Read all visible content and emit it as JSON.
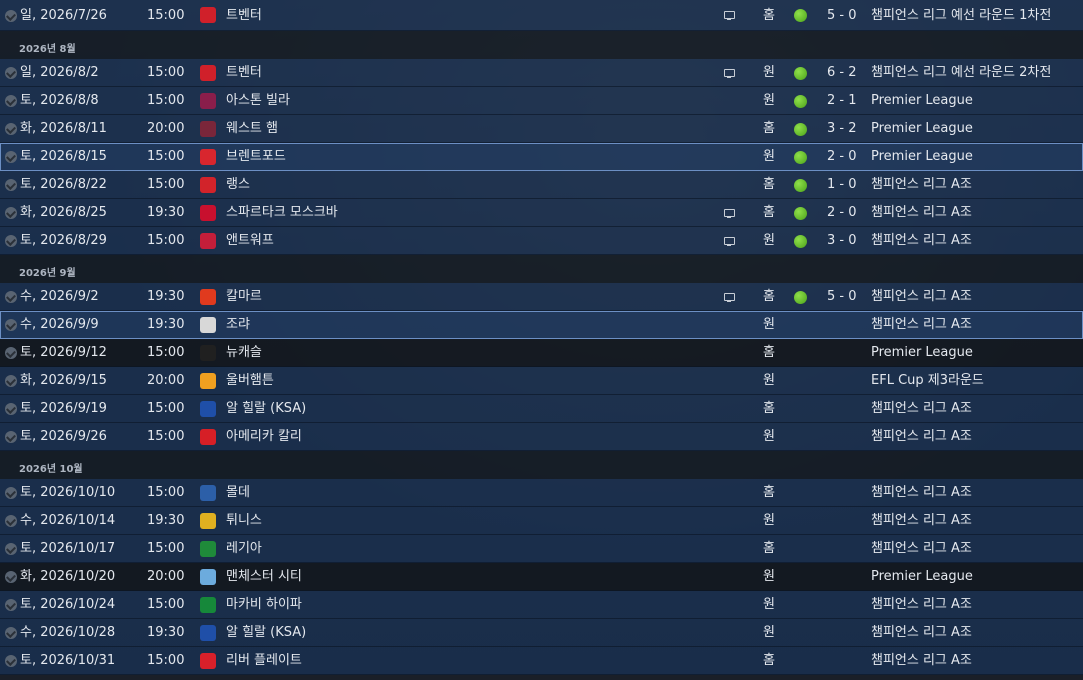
{
  "colors": {
    "win": "#5cb82a",
    "row": "#1c3556",
    "dark_row": "#161c24",
    "selected_outline": "#6c8fc4"
  },
  "months": {
    "aug": "2026년 8월",
    "sep": "2026년 9월",
    "oct": "2026년 10월"
  },
  "fixtures": [
    {
      "date": "일, 2026/7/26",
      "time": "15:00",
      "team": "트벤터",
      "badge_color": "#d0202a",
      "tv": true,
      "venue": "홈",
      "result": true,
      "score": "5 - 0",
      "comp": "챔피언스 리그 예선 라운드 1차전"
    },
    {
      "date": "일, 2026/8/2",
      "time": "15:00",
      "team": "트벤터",
      "badge_color": "#d0202a",
      "tv": true,
      "venue": "원",
      "result": true,
      "score": "6 - 2",
      "comp": "챔피언스 리그 예선 라운드 2차전"
    },
    {
      "date": "토, 2026/8/8",
      "time": "15:00",
      "team": "아스톤 빌라",
      "badge_color": "#8a1e4b",
      "tv": false,
      "venue": "원",
      "result": true,
      "score": "2 - 1",
      "comp": "Premier League"
    },
    {
      "date": "화, 2026/8/11",
      "time": "20:00",
      "team": "웨스트 햄",
      "badge_color": "#7a263a",
      "tv": false,
      "venue": "홈",
      "result": true,
      "score": "3 - 2",
      "comp": "Premier League"
    },
    {
      "date": "토, 2026/8/15",
      "time": "15:00",
      "team": "브렌트포드",
      "badge_color": "#d8262e",
      "tv": false,
      "venue": "원",
      "result": true,
      "score": "2 - 0",
      "comp": "Premier League"
    },
    {
      "date": "토, 2026/8/22",
      "time": "15:00",
      "team": "랭스",
      "badge_color": "#d2232a",
      "tv": false,
      "venue": "홈",
      "result": true,
      "score": "1 - 0",
      "comp": "챔피언스 리그 A조"
    },
    {
      "date": "화, 2026/8/25",
      "time": "19:30",
      "team": "스파르타크 모스크바",
      "badge_color": "#c8102e",
      "tv": true,
      "venue": "홈",
      "result": true,
      "score": "2 - 0",
      "comp": "챔피언스 리그 A조"
    },
    {
      "date": "토, 2026/8/29",
      "time": "15:00",
      "team": "앤트워프",
      "badge_color": "#c41e3a",
      "tv": true,
      "venue": "원",
      "result": true,
      "score": "3 - 0",
      "comp": "챔피언스 리그 A조"
    },
    {
      "date": "수, 2026/9/2",
      "time": "19:30",
      "team": "칼마르",
      "badge_color": "#e03a1e",
      "tv": true,
      "venue": "홈",
      "result": true,
      "score": "5 - 0",
      "comp": "챔피언스 리그 A조"
    },
    {
      "date": "수, 2026/9/9",
      "time": "19:30",
      "team": "조랴",
      "badge_color": "#d8d8d8",
      "tv": false,
      "venue": "원",
      "result": false,
      "score": "",
      "comp": "챔피언스 리그 A조"
    },
    {
      "date": "토, 2026/9/12",
      "time": "15:00",
      "team": "뉴캐슬",
      "badge_color": "#202020",
      "tv": false,
      "venue": "홈",
      "result": false,
      "score": "",
      "comp": "Premier League"
    },
    {
      "date": "화, 2026/9/15",
      "time": "20:00",
      "team": "울버햄튼",
      "badge_color": "#f0a020",
      "tv": false,
      "venue": "원",
      "result": false,
      "score": "",
      "comp": "EFL Cup 제3라운드"
    },
    {
      "date": "토, 2026/9/19",
      "time": "15:00",
      "team": "알 힐랄 (KSA)",
      "badge_color": "#1f4fa8",
      "tv": false,
      "venue": "홈",
      "result": false,
      "score": "",
      "comp": "챔피언스 리그 A조"
    },
    {
      "date": "토, 2026/9/26",
      "time": "15:00",
      "team": "아메리카 칼리",
      "badge_color": "#d61f26",
      "tv": false,
      "venue": "원",
      "result": false,
      "score": "",
      "comp": "챔피언스 리그 A조"
    },
    {
      "date": "토, 2026/10/10",
      "time": "15:00",
      "team": "몰데",
      "badge_color": "#2c5fa8",
      "tv": false,
      "venue": "홈",
      "result": false,
      "score": "",
      "comp": "챔피언스 리그 A조"
    },
    {
      "date": "수, 2026/10/14",
      "time": "19:30",
      "team": "튀니스",
      "badge_color": "#e0b020",
      "tv": false,
      "venue": "원",
      "result": false,
      "score": "",
      "comp": "챔피언스 리그 A조"
    },
    {
      "date": "토, 2026/10/17",
      "time": "15:00",
      "team": "레기아",
      "badge_color": "#1f8a3a",
      "tv": false,
      "venue": "홈",
      "result": false,
      "score": "",
      "comp": "챔피언스 리그 A조"
    },
    {
      "date": "화, 2026/10/20",
      "time": "20:00",
      "team": "맨체스터 시티",
      "badge_color": "#6cabdd",
      "tv": false,
      "venue": "원",
      "result": false,
      "score": "",
      "comp": "Premier League"
    },
    {
      "date": "토, 2026/10/24",
      "time": "15:00",
      "team": "마카비 하이파",
      "badge_color": "#16883a",
      "tv": false,
      "venue": "원",
      "result": false,
      "score": "",
      "comp": "챔피언스 리그 A조"
    },
    {
      "date": "수, 2026/10/28",
      "time": "19:30",
      "team": "알 힐랄 (KSA)",
      "badge_color": "#1f4fa8",
      "tv": false,
      "venue": "원",
      "result": false,
      "score": "",
      "comp": "챔피언스 리그 A조"
    },
    {
      "date": "토, 2026/10/31",
      "time": "15:00",
      "team": "리버 플레이트",
      "badge_color": "#d8202a",
      "tv": false,
      "venue": "홈",
      "result": false,
      "score": "",
      "comp": "챔피언스 리그 A조"
    }
  ]
}
